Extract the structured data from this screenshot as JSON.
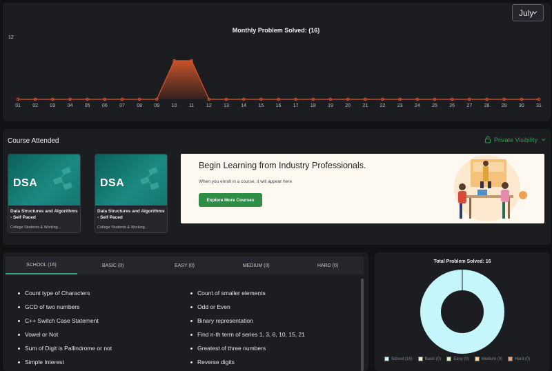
{
  "colors": {
    "accent": "#2f8d46",
    "line": "#d9532e",
    "donut": "#c4f6fb"
  },
  "month_select": {
    "value": "July"
  },
  "chart_data": {
    "type": "area",
    "title": "Monthly Problem Solved: (16)",
    "ylim": [
      0,
      12
    ],
    "ytick_label": "12",
    "x": [
      "01",
      "02",
      "03",
      "04",
      "05",
      "06",
      "07",
      "08",
      "09",
      "10",
      "11",
      "12",
      "13",
      "14",
      "15",
      "16",
      "17",
      "18",
      "19",
      "20",
      "21",
      "22",
      "23",
      "24",
      "25",
      "26",
      "27",
      "28",
      "29",
      "30",
      "31"
    ],
    "values": [
      0,
      0,
      0,
      0,
      0,
      0,
      0,
      0,
      0,
      8,
      8,
      0,
      0,
      0,
      0,
      0,
      0,
      0,
      0,
      0,
      0,
      0,
      0,
      0,
      0,
      0,
      0,
      0,
      0,
      0,
      0
    ]
  },
  "course_section": {
    "title": "Course Attended",
    "visibility": "Private Visibility",
    "cards": [
      {
        "banner": "DSA",
        "name": "Data Structures and Algorithms - Self Paced",
        "meta": "College Students & Working..."
      },
      {
        "banner": "DSA",
        "name": "Data Structures and Algorithms - Self Paced",
        "meta": "College Students & Working..."
      }
    ],
    "promo": {
      "heading": "Begin Learning from Industry Professionals.",
      "sub": "When you enroll in a course, it will appear here",
      "button": "Explore More Courses"
    }
  },
  "problems": {
    "tabs": [
      {
        "label": "SCHOOL (16)",
        "active": true
      },
      {
        "label": "BASIC (0)",
        "active": false
      },
      {
        "label": "EASY (0)",
        "active": false
      },
      {
        "label": "MEDIUM (0)",
        "active": false
      },
      {
        "label": "HARD (0)",
        "active": false
      }
    ],
    "items": [
      "Count type of Characters",
      "Count of smaller elements",
      "GCD of two numbers",
      "Odd or Even",
      "C++ Switch Case Statement",
      "Binary representation",
      "Vowel or Not",
      "Find n-th term of series 1, 3, 6, 10, 15, 21",
      "Sum of Digit is Pallindrome or not",
      "Greatest of three numbers",
      "Simple Interest",
      "Reverse digits"
    ]
  },
  "donut": {
    "title": "Total Problem Solved: 16",
    "segments": [
      {
        "label": "School (16)",
        "value": 16,
        "color": "#c4f6fb"
      },
      {
        "label": "Basic (0)",
        "value": 0,
        "color": "#e9f5c4"
      },
      {
        "label": "Easy (0)",
        "value": 0,
        "color": "#d3f0b2"
      },
      {
        "label": "Medium (0)",
        "value": 0,
        "color": "#fbd38a"
      },
      {
        "label": "Hard (0)",
        "value": 0,
        "color": "#f39a7a"
      }
    ]
  }
}
